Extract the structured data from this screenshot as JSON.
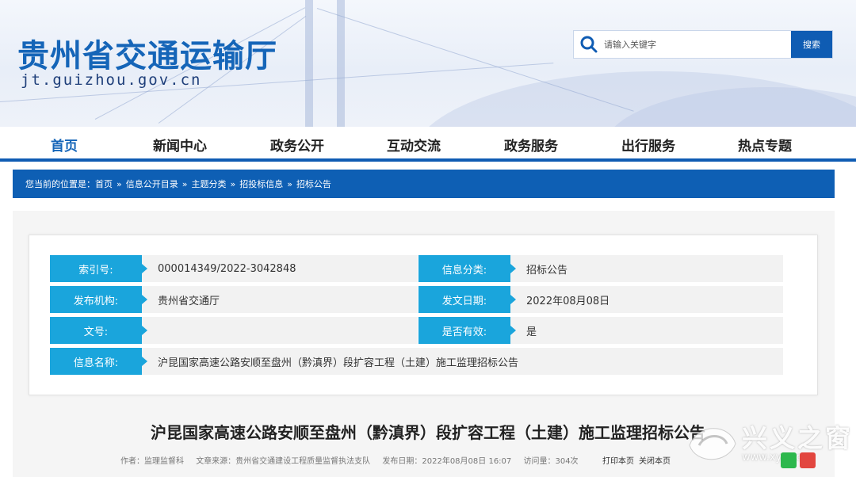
{
  "header": {
    "site_title": "贵州省交通运输厅",
    "site_domain": "jt.guizhou.gov.cn",
    "search_placeholder": "请输入关键字",
    "search_button": "搜索"
  },
  "nav": {
    "items": [
      "首页",
      "新闻中心",
      "政务公开",
      "互动交流",
      "政务服务",
      "出行服务",
      "热点专题"
    ],
    "active_index": 0
  },
  "breadcrumb": {
    "prefix": "您当前的位置是：",
    "items": [
      "首页",
      "信息公开目录",
      "主题分类",
      "招投标信息",
      "招标公告"
    ],
    "separator": "»"
  },
  "info": {
    "index_label": "索引号:",
    "index_value": "000014349/2022-3042848",
    "category_label": "信息分类:",
    "category_value": "招标公告",
    "publisher_label": "发布机构:",
    "publisher_value": "贵州省交通厅",
    "date_label": "发文日期:",
    "date_value": "2022年08月08日",
    "docno_label": "文号:",
    "docno_value": "",
    "valid_label": "是否有效:",
    "valid_value": "是",
    "name_label": "信息名称:",
    "name_value": "沪昆国家高速公路安顺至盘州（黔滇界）段扩容工程（土建）施工监理招标公告"
  },
  "article": {
    "title": "沪昆国家高速公路安顺至盘州（黔滇界）段扩容工程（土建）施工监理招标公告",
    "author": "作者：监理监督科",
    "source": "文章来源：贵州省交通建设工程质量监督执法支队",
    "publish_time": "发布日期：2022年08月08日 16:07",
    "views": "访问量：304次",
    "print_label": "打印本页",
    "close_label": "关闭本页"
  },
  "watermark": {
    "text": "兴义之窗",
    "url": "www.xyzc.cn"
  },
  "colors": {
    "brand_blue": "#0f5cb3",
    "label_cyan": "#1aa5dc"
  }
}
